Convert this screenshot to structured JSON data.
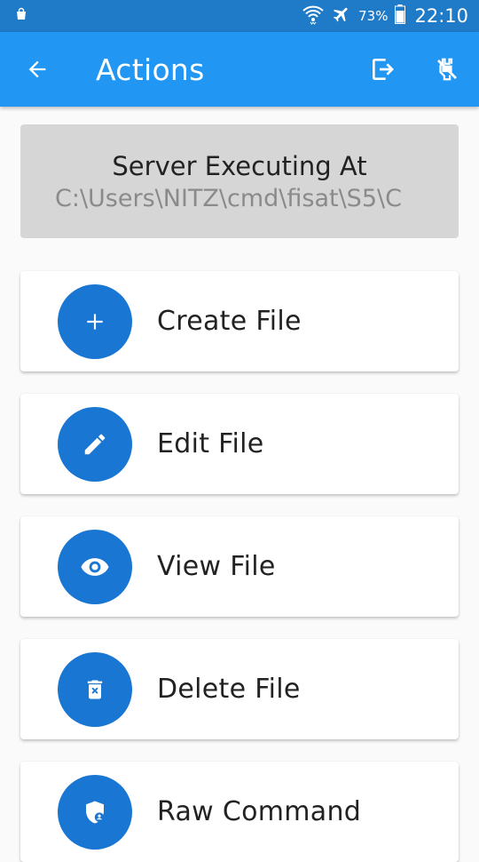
{
  "status_bar": {
    "battery_percent": "73%",
    "time": "22:10",
    "icons": [
      "bag-icon",
      "wifi-icon",
      "airplane-icon",
      "battery-icon"
    ]
  },
  "app_bar": {
    "title": "Actions",
    "icons": [
      "arrow-back-icon",
      "logout-icon",
      "power-off-icon"
    ],
    "color": "#2196f3"
  },
  "server": {
    "title": "Server Executing At",
    "path": "C:\\Users\\NITZ\\cmd\\fisat\\S5\\C"
  },
  "actions": [
    {
      "label": "Create File",
      "icon": "plus-icon"
    },
    {
      "label": "Edit File",
      "icon": "pencil-icon"
    },
    {
      "label": "View File",
      "icon": "eye-icon"
    },
    {
      "label": "Delete File",
      "icon": "trash-icon"
    },
    {
      "label": "Raw Command",
      "icon": "shield-user-icon"
    }
  ],
  "colors": {
    "accent": "#1976d2",
    "status_bar": "#1f7bc8",
    "server_box": "#d6d6d6"
  }
}
